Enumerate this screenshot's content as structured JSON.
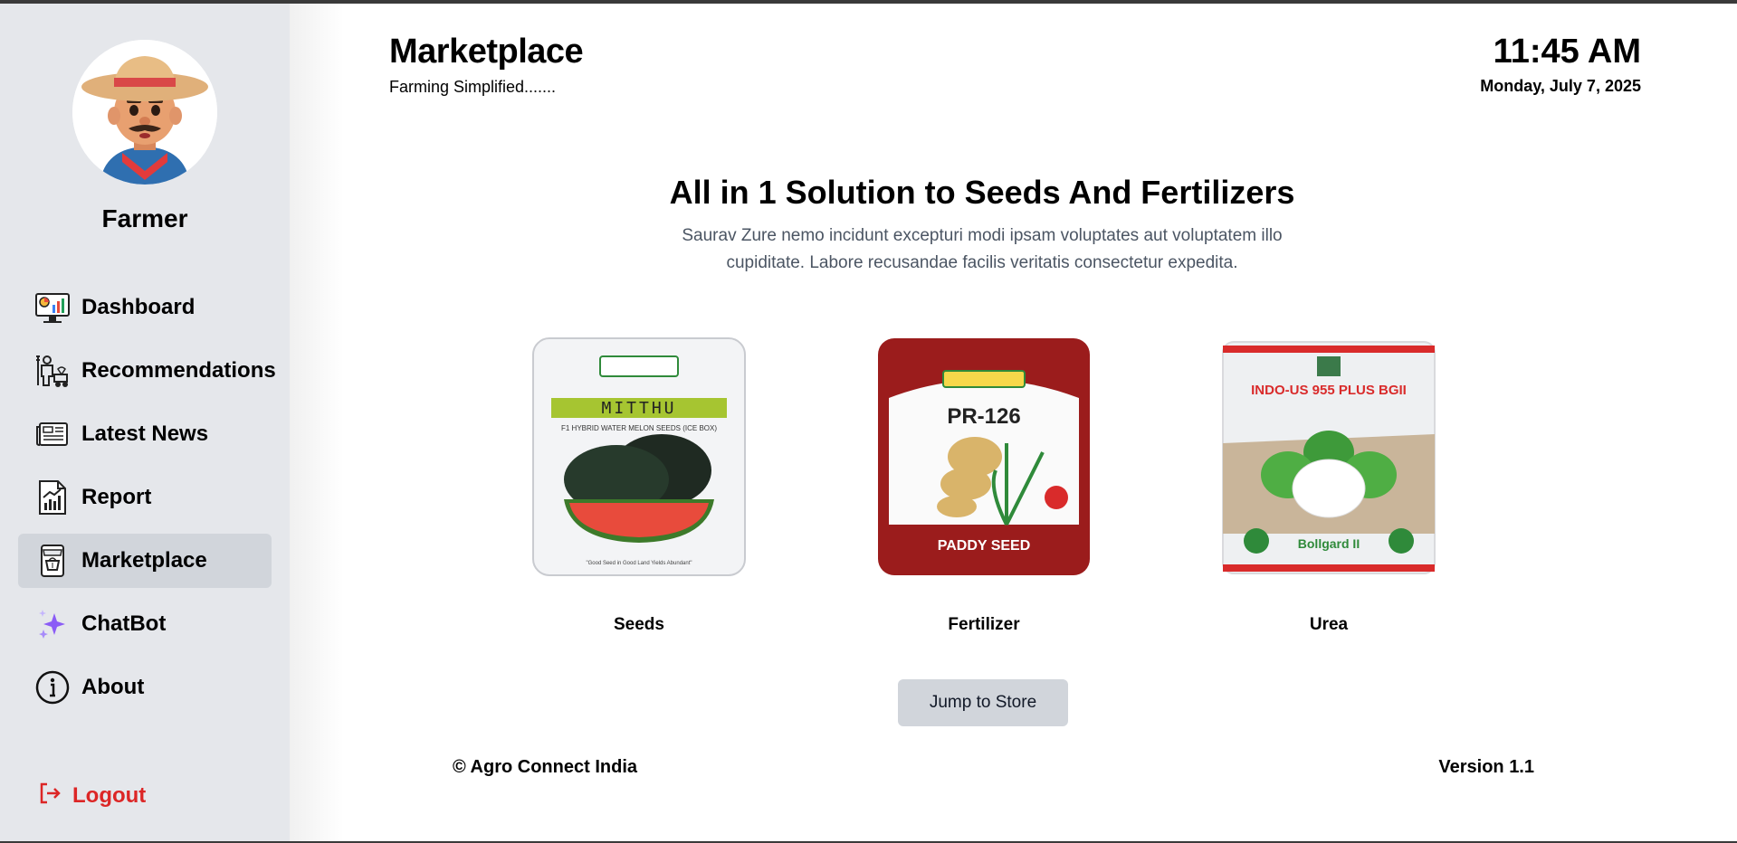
{
  "sidebar": {
    "user_name": "Farmer",
    "items": [
      {
        "label": "Dashboard",
        "icon": "dashboard-icon"
      },
      {
        "label": "Recommendations",
        "icon": "farmer-tractor-icon"
      },
      {
        "label": "Latest News",
        "icon": "newspaper-icon"
      },
      {
        "label": "Report",
        "icon": "report-chart-icon"
      },
      {
        "label": "Marketplace",
        "icon": "shop-icon",
        "active": true
      },
      {
        "label": "ChatBot",
        "icon": "sparkles-icon"
      },
      {
        "label": "About",
        "icon": "info-icon"
      }
    ],
    "logout_label": "Logout",
    "logout_color": "#dc2626"
  },
  "header": {
    "title": "Marketplace",
    "subtitle": "Farming Simplified.......",
    "time": "11:45 AM",
    "date": "Monday, July 7, 2025"
  },
  "hero": {
    "title": "All in 1 Solution to Seeds And Fertilizers",
    "text": "Saurav Zure nemo incidunt excepturi modi ipsam voluptates aut voluptatem illo cupiditate. Labore recusandae facilis veritatis consectetur expedita."
  },
  "products": [
    {
      "name": "Seeds",
      "pack": {
        "brand": "MITTHU",
        "line1": "F1 HYBRID WATER MELON SEEDS (ICE BOX)",
        "footer": "\"Good Seed in Good Land Yields Abundant\""
      }
    },
    {
      "name": "Fertilizer",
      "pack": {
        "brand": "PR-126",
        "footer": "PADDY SEED"
      }
    },
    {
      "name": "Urea",
      "pack": {
        "brand": "INDO-US 955 PLUS BGII",
        "footer": "Bollgard II"
      }
    }
  ],
  "store_button": "Jump to Store",
  "footer": {
    "copyright": "© Agro Connect India",
    "version": "Version 1.1"
  },
  "colors": {
    "sidebar_bg": "#e5e7eb",
    "active_bg": "#d1d5db",
    "button_bg": "#d1d5db",
    "logout": "#dc2626"
  }
}
